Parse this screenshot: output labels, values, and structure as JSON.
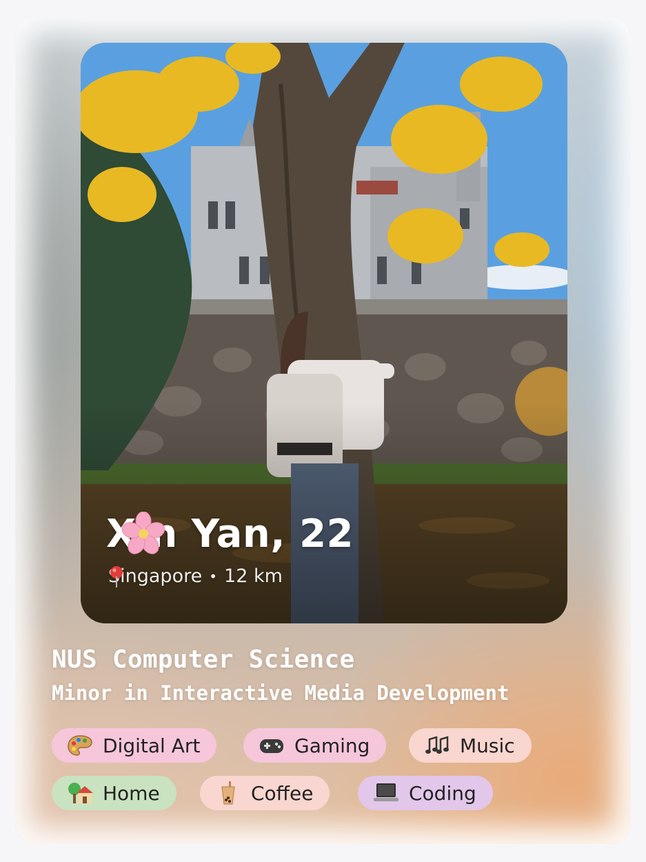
{
  "profile": {
    "name_age": "Xin Yan, 22",
    "flower_emoji_icon": "cherry-blossom-icon",
    "location": "Singapore",
    "separator": "•",
    "distance": "12 km",
    "major": "NUS Computer Science",
    "minor": "Minor in Interactive Media Development"
  },
  "tags": [
    {
      "label": "Digital Art",
      "icon": "palette-icon",
      "color": "#f6c6db"
    },
    {
      "label": "Gaming",
      "icon": "game-controller-icon",
      "color": "#f6c6db"
    },
    {
      "label": "Music",
      "icon": "music-notes-icon",
      "color": "#f9d6cf"
    },
    {
      "label": "Home",
      "icon": "house-icon",
      "color": "#c9e3c0"
    },
    {
      "label": "Coffee",
      "icon": "bubble-tea-icon",
      "color": "#f9d6cf"
    },
    {
      "label": "Coding",
      "icon": "laptop-icon",
      "color": "#e2c7ea"
    }
  ]
}
